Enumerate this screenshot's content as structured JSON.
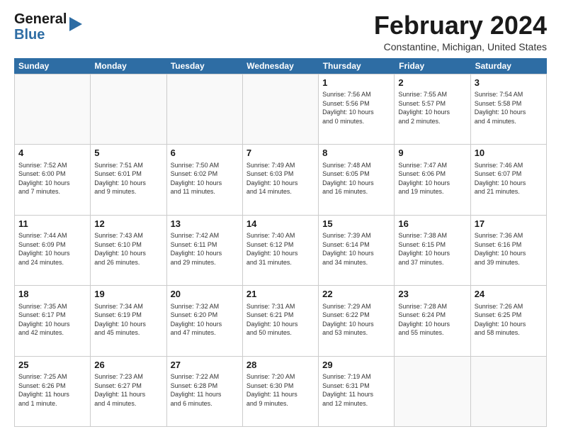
{
  "logo": {
    "line1": "General",
    "line2": "Blue"
  },
  "title": "February 2024",
  "location": "Constantine, Michigan, United States",
  "days_of_week": [
    "Sunday",
    "Monday",
    "Tuesday",
    "Wednesday",
    "Thursday",
    "Friday",
    "Saturday"
  ],
  "weeks": [
    [
      {
        "day": "",
        "info": ""
      },
      {
        "day": "",
        "info": ""
      },
      {
        "day": "",
        "info": ""
      },
      {
        "day": "",
        "info": ""
      },
      {
        "day": "1",
        "info": "Sunrise: 7:56 AM\nSunset: 5:56 PM\nDaylight: 10 hours\nand 0 minutes."
      },
      {
        "day": "2",
        "info": "Sunrise: 7:55 AM\nSunset: 5:57 PM\nDaylight: 10 hours\nand 2 minutes."
      },
      {
        "day": "3",
        "info": "Sunrise: 7:54 AM\nSunset: 5:58 PM\nDaylight: 10 hours\nand 4 minutes."
      }
    ],
    [
      {
        "day": "4",
        "info": "Sunrise: 7:52 AM\nSunset: 6:00 PM\nDaylight: 10 hours\nand 7 minutes."
      },
      {
        "day": "5",
        "info": "Sunrise: 7:51 AM\nSunset: 6:01 PM\nDaylight: 10 hours\nand 9 minutes."
      },
      {
        "day": "6",
        "info": "Sunrise: 7:50 AM\nSunset: 6:02 PM\nDaylight: 10 hours\nand 11 minutes."
      },
      {
        "day": "7",
        "info": "Sunrise: 7:49 AM\nSunset: 6:03 PM\nDaylight: 10 hours\nand 14 minutes."
      },
      {
        "day": "8",
        "info": "Sunrise: 7:48 AM\nSunset: 6:05 PM\nDaylight: 10 hours\nand 16 minutes."
      },
      {
        "day": "9",
        "info": "Sunrise: 7:47 AM\nSunset: 6:06 PM\nDaylight: 10 hours\nand 19 minutes."
      },
      {
        "day": "10",
        "info": "Sunrise: 7:46 AM\nSunset: 6:07 PM\nDaylight: 10 hours\nand 21 minutes."
      }
    ],
    [
      {
        "day": "11",
        "info": "Sunrise: 7:44 AM\nSunset: 6:09 PM\nDaylight: 10 hours\nand 24 minutes."
      },
      {
        "day": "12",
        "info": "Sunrise: 7:43 AM\nSunset: 6:10 PM\nDaylight: 10 hours\nand 26 minutes."
      },
      {
        "day": "13",
        "info": "Sunrise: 7:42 AM\nSunset: 6:11 PM\nDaylight: 10 hours\nand 29 minutes."
      },
      {
        "day": "14",
        "info": "Sunrise: 7:40 AM\nSunset: 6:12 PM\nDaylight: 10 hours\nand 31 minutes."
      },
      {
        "day": "15",
        "info": "Sunrise: 7:39 AM\nSunset: 6:14 PM\nDaylight: 10 hours\nand 34 minutes."
      },
      {
        "day": "16",
        "info": "Sunrise: 7:38 AM\nSunset: 6:15 PM\nDaylight: 10 hours\nand 37 minutes."
      },
      {
        "day": "17",
        "info": "Sunrise: 7:36 AM\nSunset: 6:16 PM\nDaylight: 10 hours\nand 39 minutes."
      }
    ],
    [
      {
        "day": "18",
        "info": "Sunrise: 7:35 AM\nSunset: 6:17 PM\nDaylight: 10 hours\nand 42 minutes."
      },
      {
        "day": "19",
        "info": "Sunrise: 7:34 AM\nSunset: 6:19 PM\nDaylight: 10 hours\nand 45 minutes."
      },
      {
        "day": "20",
        "info": "Sunrise: 7:32 AM\nSunset: 6:20 PM\nDaylight: 10 hours\nand 47 minutes."
      },
      {
        "day": "21",
        "info": "Sunrise: 7:31 AM\nSunset: 6:21 PM\nDaylight: 10 hours\nand 50 minutes."
      },
      {
        "day": "22",
        "info": "Sunrise: 7:29 AM\nSunset: 6:22 PM\nDaylight: 10 hours\nand 53 minutes."
      },
      {
        "day": "23",
        "info": "Sunrise: 7:28 AM\nSunset: 6:24 PM\nDaylight: 10 hours\nand 55 minutes."
      },
      {
        "day": "24",
        "info": "Sunrise: 7:26 AM\nSunset: 6:25 PM\nDaylight: 10 hours\nand 58 minutes."
      }
    ],
    [
      {
        "day": "25",
        "info": "Sunrise: 7:25 AM\nSunset: 6:26 PM\nDaylight: 11 hours\nand 1 minute."
      },
      {
        "day": "26",
        "info": "Sunrise: 7:23 AM\nSunset: 6:27 PM\nDaylight: 11 hours\nand 4 minutes."
      },
      {
        "day": "27",
        "info": "Sunrise: 7:22 AM\nSunset: 6:28 PM\nDaylight: 11 hours\nand 6 minutes."
      },
      {
        "day": "28",
        "info": "Sunrise: 7:20 AM\nSunset: 6:30 PM\nDaylight: 11 hours\nand 9 minutes."
      },
      {
        "day": "29",
        "info": "Sunrise: 7:19 AM\nSunset: 6:31 PM\nDaylight: 11 hours\nand 12 minutes."
      },
      {
        "day": "",
        "info": ""
      },
      {
        "day": "",
        "info": ""
      }
    ]
  ]
}
